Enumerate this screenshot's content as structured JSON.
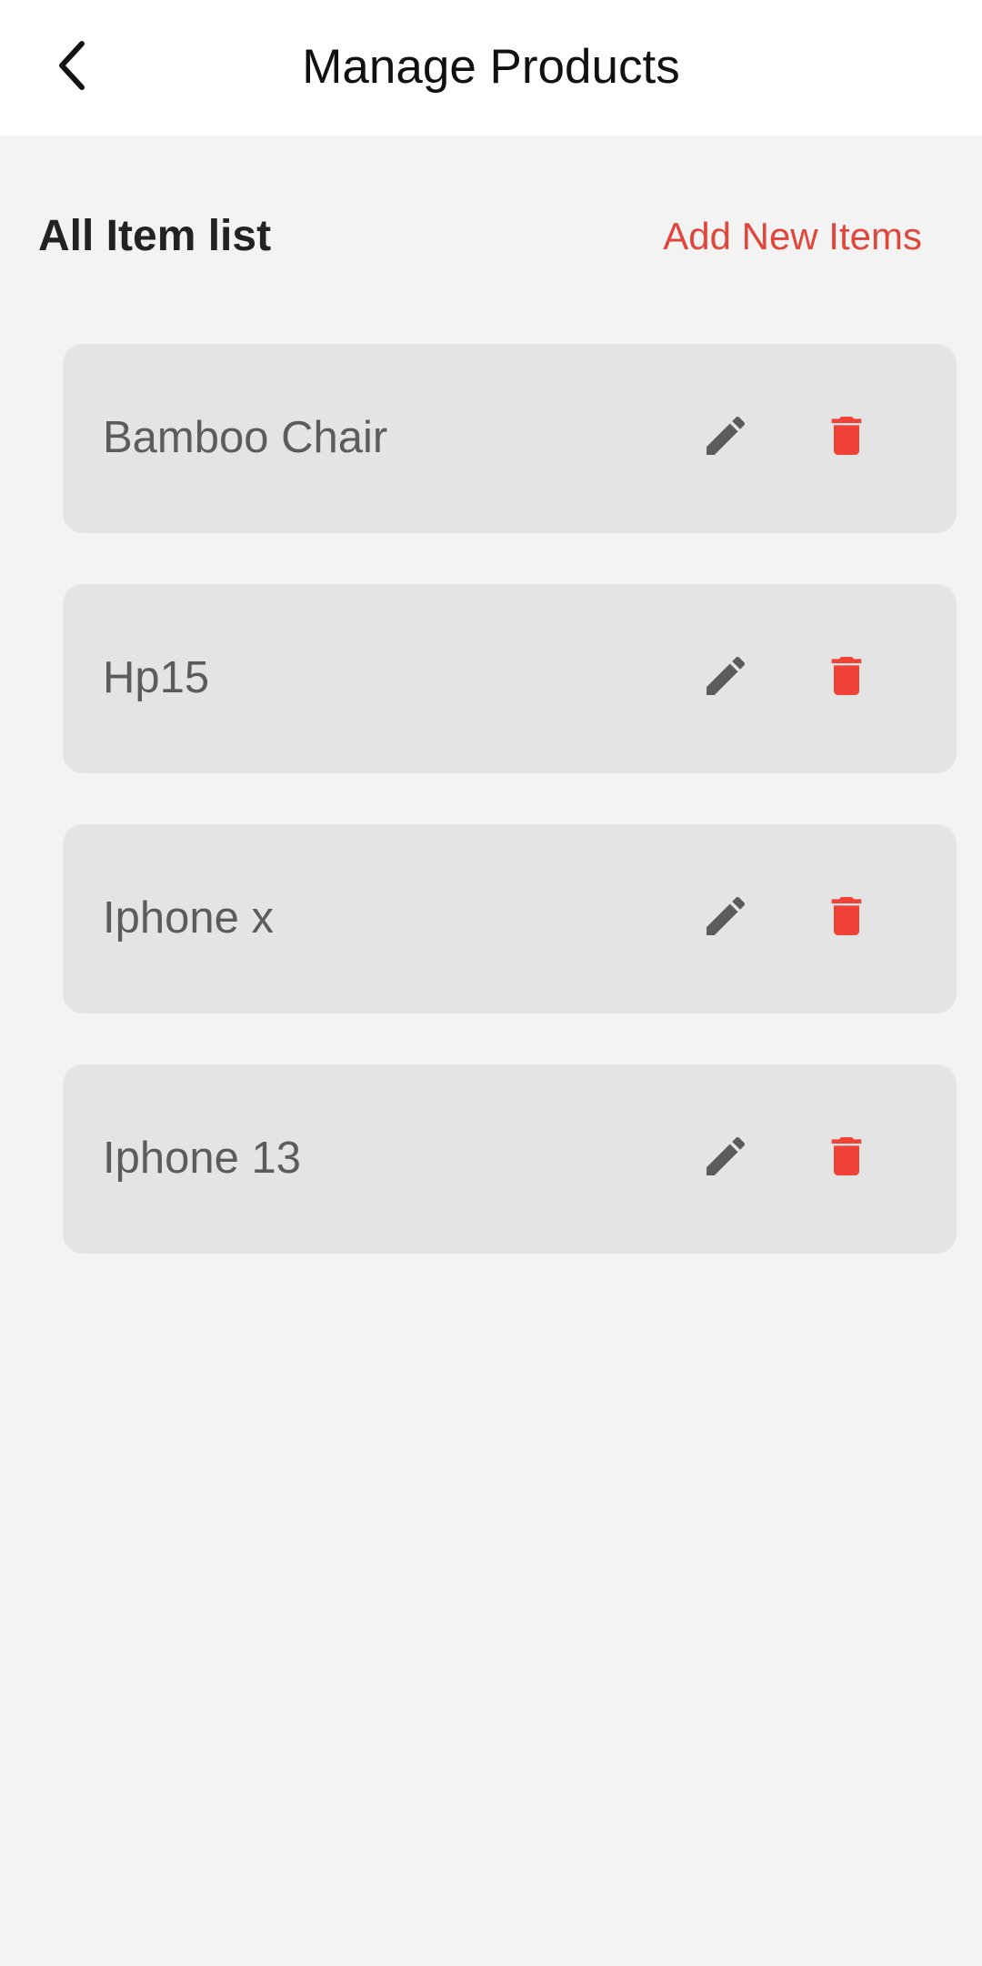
{
  "header": {
    "title": "Manage Products",
    "back_icon": "chevron-left-icon"
  },
  "section": {
    "title": "All Item list",
    "add_link": "Add New Items"
  },
  "colors": {
    "accent": "#e0473c",
    "delete": "#ef4136",
    "edit": "#5c5c5c",
    "card": "#e4e4e4",
    "background": "#f3f3f3"
  },
  "items": [
    {
      "name": "Bamboo Chair"
    },
    {
      "name": "Hp15"
    },
    {
      "name": "Iphone x"
    },
    {
      "name": "Iphone 13"
    }
  ],
  "icons": {
    "edit": "pencil-icon",
    "delete": "trash-icon"
  }
}
